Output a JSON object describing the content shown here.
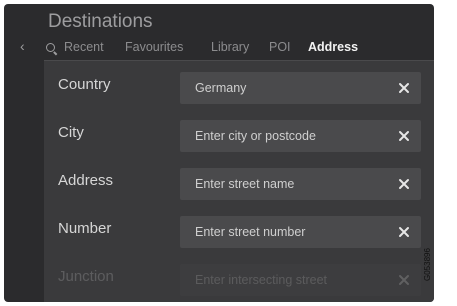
{
  "screen": {
    "title": "Destinations",
    "back_icon": "chevron-left-icon",
    "search_icon": "search-icon"
  },
  "tabs": [
    {
      "label": "Recent",
      "active": false
    },
    {
      "label": "Favourites",
      "active": false
    },
    {
      "label": "Library",
      "active": false
    },
    {
      "label": "POI",
      "active": false
    },
    {
      "label": "Address",
      "active": true
    }
  ],
  "form": {
    "rows": [
      {
        "label": "Country",
        "value": "Germany",
        "placeholder": ""
      },
      {
        "label": "City",
        "value": "",
        "placeholder": "Enter city or postcode"
      },
      {
        "label": "Address",
        "value": "",
        "placeholder": "Enter street name"
      },
      {
        "label": "Number",
        "value": "",
        "placeholder": "Enter street number"
      },
      {
        "label": "Junction",
        "value": "",
        "placeholder": "Enter intersecting street"
      }
    ],
    "clear_icon": "close-icon"
  },
  "image_code": "G053896",
  "colors": {
    "screen_bg": "#2b2b2d",
    "panel_bg": "#3a3a3c",
    "field_bg": "#4a4a4c",
    "active_tab": "#f2f2f2",
    "inactive_tab": "#8c8c8e"
  }
}
